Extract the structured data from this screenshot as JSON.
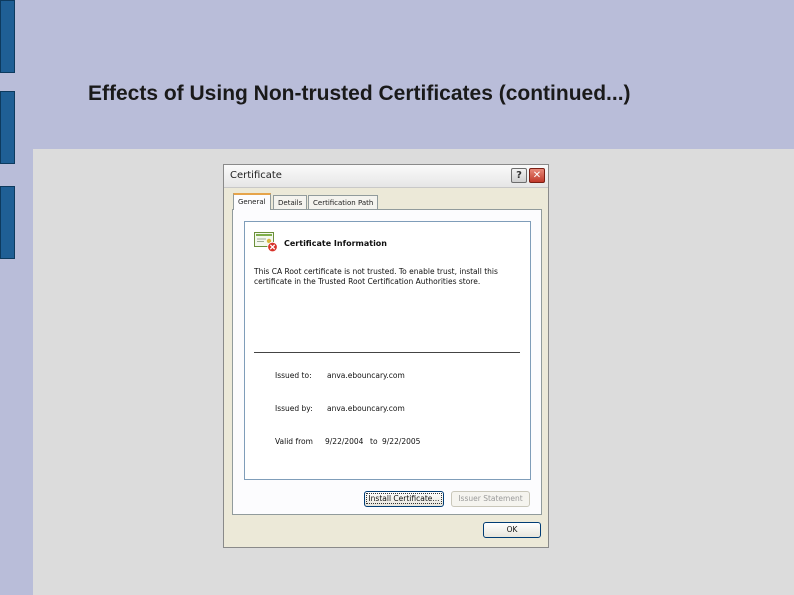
{
  "slide": {
    "title": "Effects of Using Non-trusted Certificates (continued...)"
  },
  "dialog": {
    "title": "Certificate",
    "help_glyph": "?",
    "close_glyph": "✕",
    "tabs": [
      {
        "label": "General",
        "active": true
      },
      {
        "label": "Details",
        "active": false
      },
      {
        "label": "Certification Path",
        "active": false
      }
    ],
    "info": {
      "heading": "Certificate Information",
      "warning": "This CA Root certificate is not trusted. To enable trust, install this certificate in the Trusted Root Certification Authorities store.",
      "issued_to_label": "Issued to:",
      "issued_to_value": "anva.ebouncary.com",
      "issued_by_label": "Issued by:",
      "issued_by_value": "anva.ebouncary.com",
      "valid_from_label": "Valid from",
      "valid_from_value": "9/22/2004",
      "valid_to_word": "to",
      "valid_to_value": "9/22/2005"
    },
    "buttons": {
      "install": "Install Certificate...",
      "issuer_statement": "Issuer Statement",
      "ok": "OK"
    }
  },
  "colors": {
    "slide_background": "#b9bdd9",
    "content_area": "#dcdcdc",
    "accent_bar": "#1f5f95",
    "dialog_face": "#ece9d8",
    "close_button": "#c0392b",
    "active_tab_highlight": "#e6a44a"
  },
  "icons": {
    "certificate": "certificate-error-icon"
  }
}
